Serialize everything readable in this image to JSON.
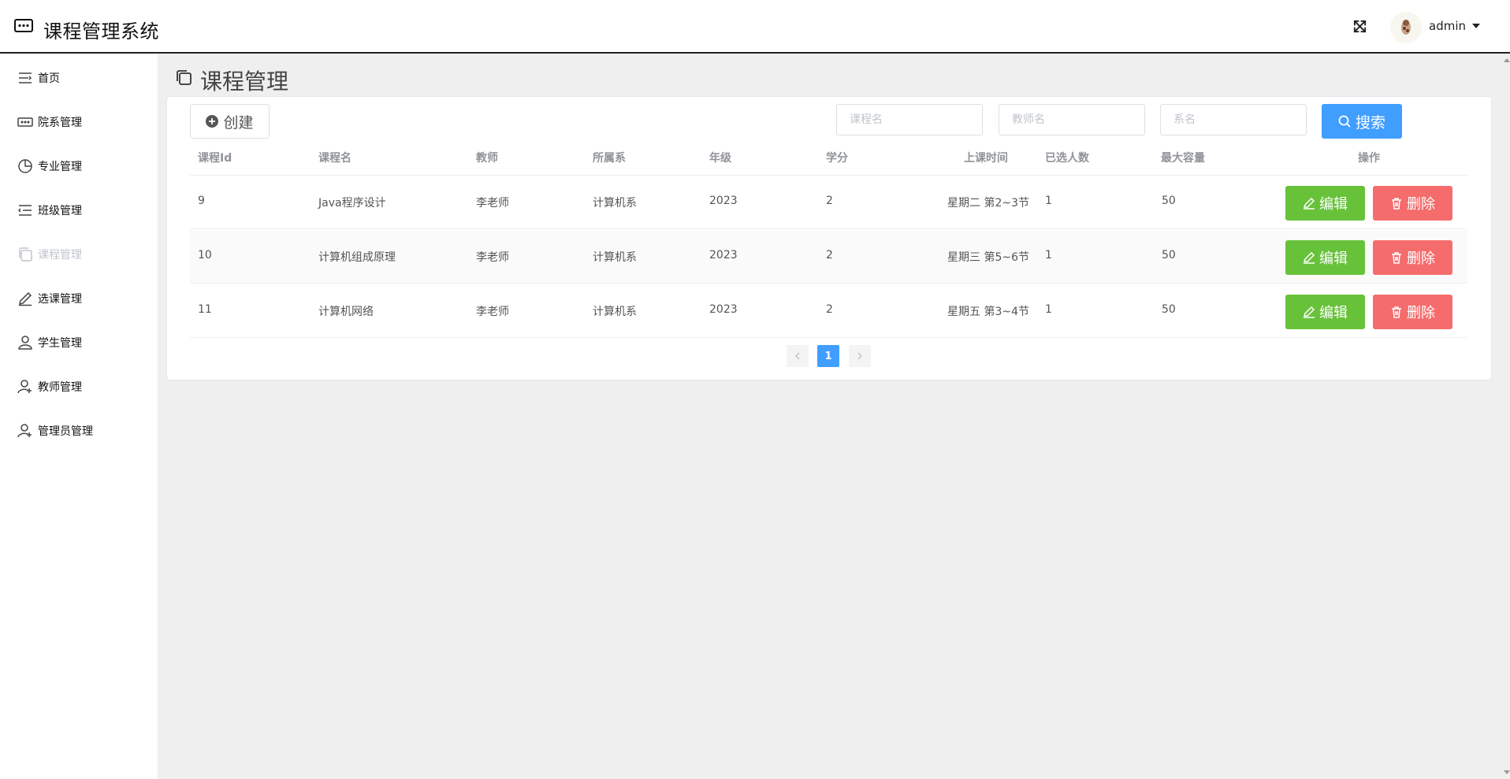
{
  "header": {
    "app_title": "课程管理系统",
    "user_name": "admin"
  },
  "sidebar": {
    "items": [
      {
        "label": "首页",
        "icon": "menu-lines-icon"
      },
      {
        "label": "院系管理",
        "icon": "more-dots-icon"
      },
      {
        "label": "专业管理",
        "icon": "pie-chart-icon"
      },
      {
        "label": "班级管理",
        "icon": "list-icon"
      },
      {
        "label": "课程管理",
        "icon": "copy-document-icon",
        "active": true
      },
      {
        "label": "选课管理",
        "icon": "edit-pen-icon"
      },
      {
        "label": "学生管理",
        "icon": "user-icon"
      },
      {
        "label": "教师管理",
        "icon": "user-add-icon"
      },
      {
        "label": "管理员管理",
        "icon": "user-add-icon"
      }
    ]
  },
  "main": {
    "page_title": "课程管理",
    "toolbar": {
      "create_label": "创建",
      "course_placeholder": "课程名",
      "teacher_placeholder": "教师名",
      "department_placeholder": "系名",
      "search_label": "搜索"
    },
    "table": {
      "headers": [
        "课程Id",
        "课程名",
        "教师",
        "所属系",
        "年级",
        "学分",
        "上课时间",
        "已选人数",
        "最大容量",
        "操作"
      ],
      "rows": [
        {
          "id": "9",
          "name": "Java程序设计",
          "teacher": "李老师",
          "department": "计算机系",
          "grade": "2023",
          "credit": "2",
          "time": "星期二 第2~3节",
          "selected": "1",
          "capacity": "50"
        },
        {
          "id": "10",
          "name": "计算机组成原理",
          "teacher": "李老师",
          "department": "计算机系",
          "grade": "2023",
          "credit": "2",
          "time": "星期三 第5~6节",
          "selected": "1",
          "capacity": "50"
        },
        {
          "id": "11",
          "name": "计算机网络",
          "teacher": "李老师",
          "department": "计算机系",
          "grade": "2023",
          "credit": "2",
          "time": "星期五 第3~4节",
          "selected": "1",
          "capacity": "50"
        }
      ],
      "edit_label": "编辑",
      "delete_label": "删除"
    },
    "pagination": {
      "current_page": "1"
    }
  },
  "colors": {
    "primary": "#409eff",
    "success": "#67c23a",
    "danger": "#f56c6c"
  }
}
